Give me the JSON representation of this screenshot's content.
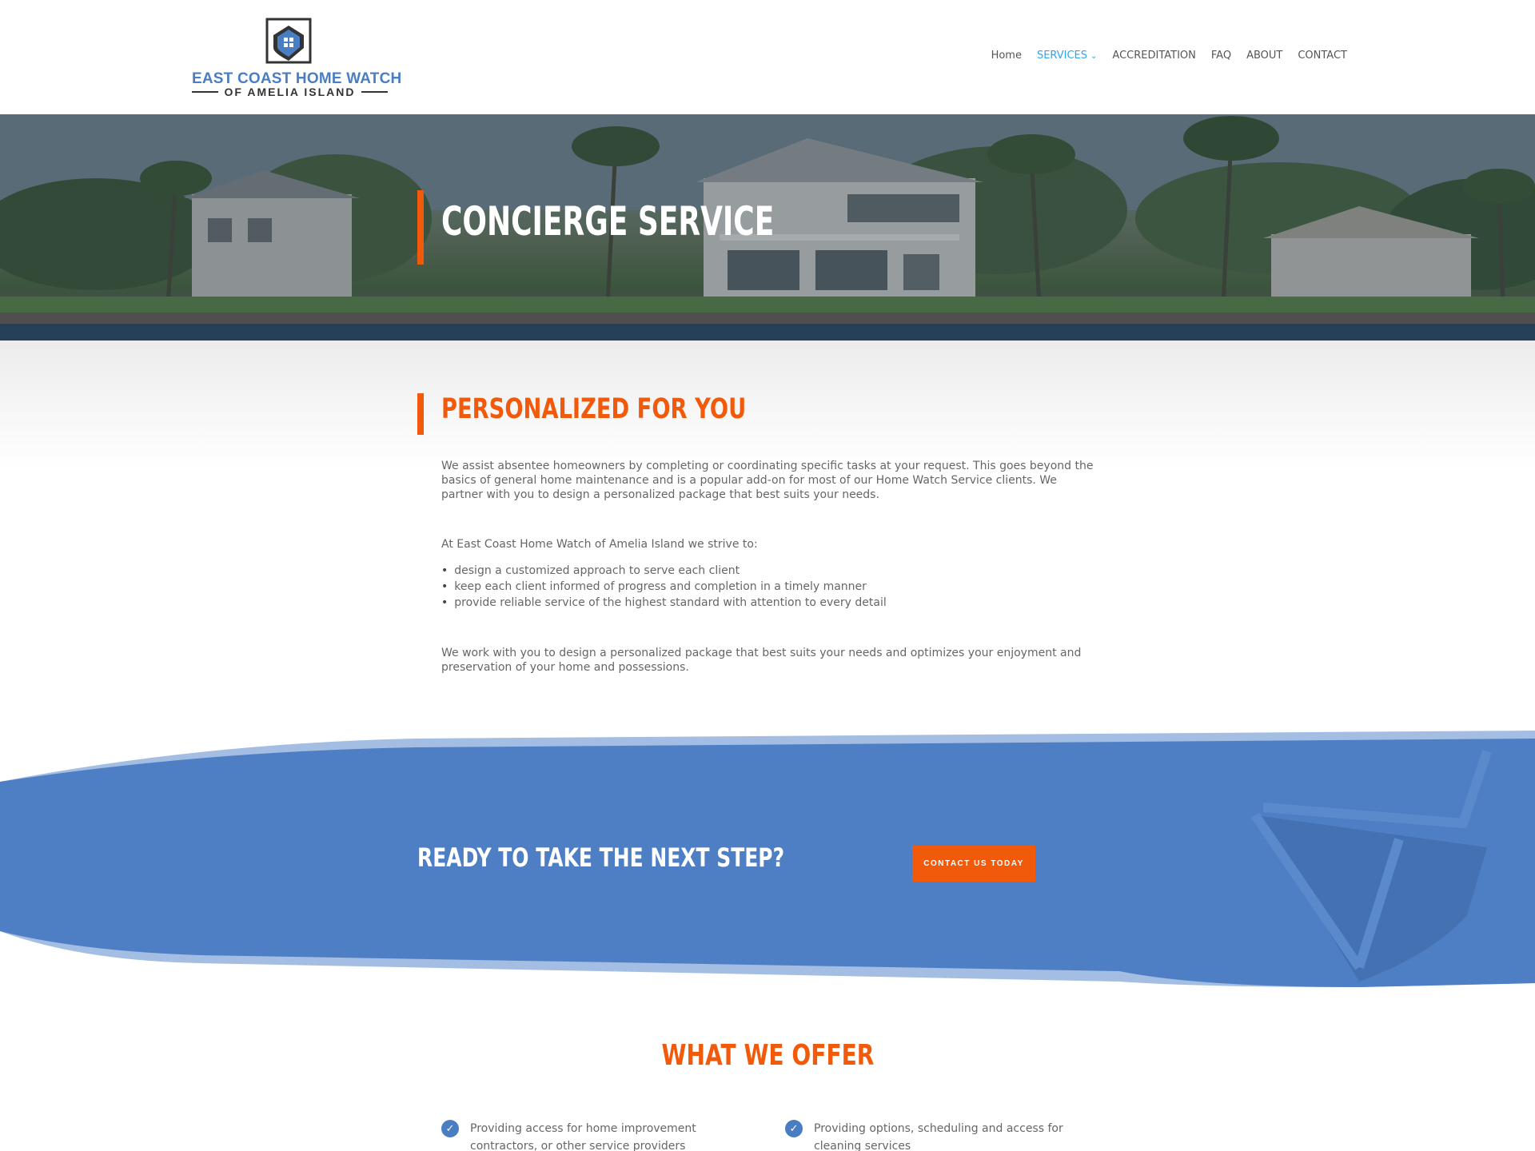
{
  "brand": {
    "line1": "EAST COAST HOME WATCH",
    "line2": "OF AMELIA ISLAND"
  },
  "nav": {
    "items": [
      {
        "label": "Home",
        "active": false
      },
      {
        "label": "SERVICES",
        "active": true,
        "dropdown": true
      },
      {
        "label": "ACCREDITATION",
        "active": false
      },
      {
        "label": "FAQ",
        "active": false
      },
      {
        "label": "ABOUT",
        "active": false
      },
      {
        "label": "CONTACT",
        "active": false
      }
    ]
  },
  "hero": {
    "title": "CONCIERGE SERVICE"
  },
  "main": {
    "heading": "PERSONALIZED FOR YOU",
    "intro": "We assist absentee homeowners by completing or coordinating specific tasks at your request. This goes beyond the basics of general home maintenance and is a popular add-on for most of our Home Watch Service clients. We partner with you to design a personalized package that best suits your needs.",
    "strive_lead": "At East Coast Home Watch of Amelia Island we strive to:",
    "bullets": [
      "design a customized approach to serve each client",
      "keep each client informed of progress and completion in a timely manner",
      "provide reliable service of the highest standard with attention to every detail"
    ],
    "closing": "We work with you to design a personalized package that best suits your needs and optimizes your enjoyment and preservation of your home and possessions."
  },
  "cta": {
    "title": "READY TO TAKE THE NEXT STEP?",
    "button": "CONTACT US TODAY"
  },
  "offer": {
    "title": "WHAT WE OFFER",
    "items": [
      "Providing access for home improvement contractors, or other service providers",
      "Providing options, scheduling and access for cleaning services"
    ]
  },
  "colors": {
    "accent": "#f15a0b",
    "brand_blue": "#4a7ec3",
    "nav_active": "#2ea3f2"
  }
}
